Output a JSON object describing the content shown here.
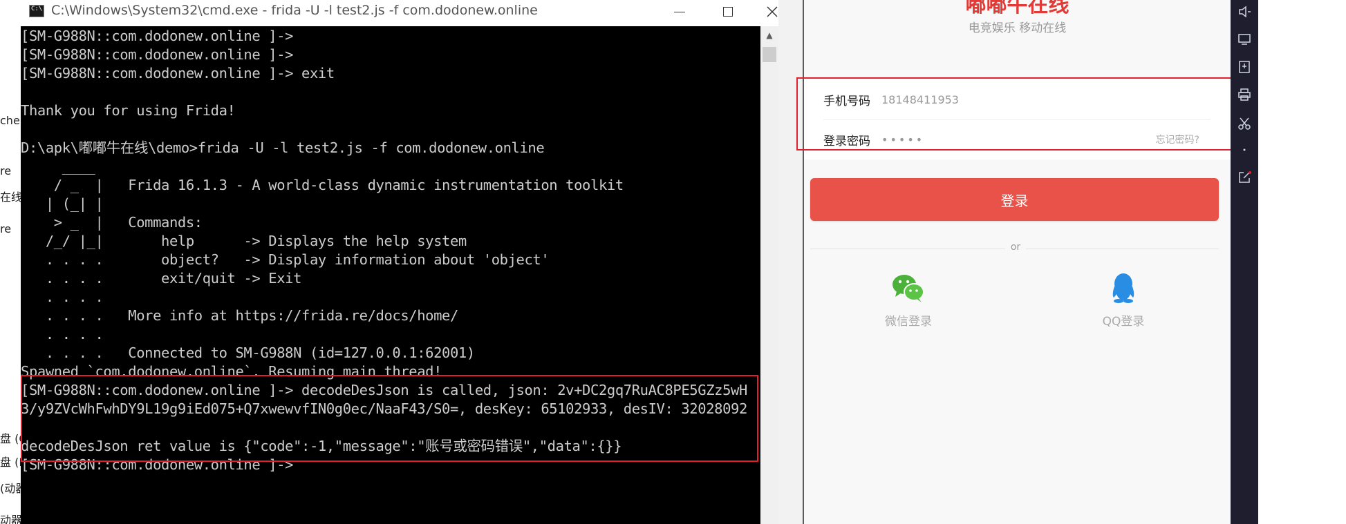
{
  "left_fragments": [
    "che",
    "re",
    "在线",
    "re",
    "盘 (C",
    "盘 (D",
    "(动器",
    "动器"
  ],
  "cmd": {
    "title": "C:\\Windows\\System32\\cmd.exe - frida  -U -l test2.js -f com.dodonew.online",
    "lines": [
      "[SM-G988N::com.dodonew.online ]->",
      "[SM-G988N::com.dodonew.online ]->",
      "[SM-G988N::com.dodonew.online ]-> exit",
      "",
      "Thank you for using Frida!",
      "",
      "D:\\apk\\嘟嘟牛在线\\demo>frida -U -l test2.js -f com.dodonew.online",
      "     ____",
      "    / _  |   Frida 16.1.3 - A world-class dynamic instrumentation toolkit",
      "   | (_| |",
      "    > _  |   Commands:",
      "   /_/ |_|       help      -> Displays the help system",
      "   . . . .       object?   -> Display information about 'object'",
      "   . . . .       exit/quit -> Exit",
      "   . . . .",
      "   . . . .   More info at https://frida.re/docs/home/",
      "   . . . .",
      "   . . . .   Connected to SM-G988N (id=127.0.0.1:62001)",
      "Spawned `com.dodonew.online`. Resuming main thread!",
      "[SM-G988N::com.dodonew.online ]-> decodeDesJson is called, json: 2v+DC2gq7RuAC8PE5GZz5wH",
      "3/y9ZVcWhFwhDY9L19g9iEd075+Q7xwewvfIN0g0ec/NaaF43/S0=, desKey: 65102933, desIV: 32028092",
      "",
      "decodeDesJson ret value is {\"code\":-1,\"message\":\"账号或密码错误\",\"data\":{}}",
      "[SM-G988N::com.dodonew.online ]->"
    ]
  },
  "app": {
    "title": "嘟嘟牛在线",
    "subtitle": "电竞娱乐 移动在线",
    "phone_label": "手机号码",
    "phone_value": "18148411953",
    "password_label": "登录密码",
    "password_value": "•••••",
    "forgot_label": "忘记密码?",
    "login_label": "登录",
    "or_label": "or",
    "wechat_label": "微信登录",
    "qq_label": "QQ登录"
  },
  "colors": {
    "accent": "#e85248",
    "highlight": "#e0202a",
    "wechat": "#4cb13a",
    "qq": "#2a8de4"
  },
  "toolbar_icons": [
    "volume-down-icon",
    "screen-icon",
    "apk-install-icon",
    "print-icon",
    "scissors-icon",
    "more-icon",
    "share-icon"
  ]
}
